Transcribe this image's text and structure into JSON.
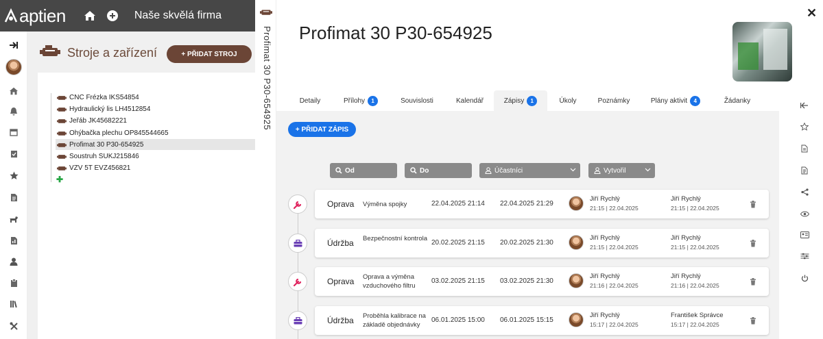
{
  "topbar": {
    "brand": "aptien",
    "company": "Naše skvělá firma"
  },
  "midpanel": {
    "title": "Stroje a zařízení",
    "add_button": "+ PŘIDAT STROJ",
    "tree": [
      {
        "label": "CNC Frézka IKS54854"
      },
      {
        "label": "Hydraulický lis LH4512854"
      },
      {
        "label": "Jeřáb JK45682221"
      },
      {
        "label": "Ohýbačka plechu OP845544665"
      },
      {
        "label": "Profimat 30 P30-654925",
        "selected": true
      },
      {
        "label": "Soustruh SUKJ215846"
      },
      {
        "label": "VZV 5T EVZ456821"
      }
    ]
  },
  "vertical_title": "Profimat 30 P30-654925",
  "detail": {
    "title": "Profimat 30 P30-654925",
    "tabs": [
      {
        "label": "Detaily",
        "badge": ""
      },
      {
        "label": "Přílohy",
        "badge": "1"
      },
      {
        "label": "Souvislosti",
        "badge": ""
      },
      {
        "label": "Kalendář",
        "badge": ""
      },
      {
        "label": "Zápisy",
        "badge": "1"
      },
      {
        "label": "Úkoly",
        "badge": ""
      },
      {
        "label": "Poznámky",
        "badge": ""
      },
      {
        "label": "Plány aktivit",
        "badge": "4"
      },
      {
        "label": "Žádanky",
        "badge": ""
      }
    ],
    "active_tab": "Zápisy",
    "add_button": "+ PŘIDAT ZÁPIS",
    "filters": {
      "od": "Od",
      "do": "Do",
      "ucastnici": "Účastníci",
      "vytvoril": "Vytvořil"
    },
    "records": [
      {
        "type": "Oprava",
        "icon": "wrench-icon",
        "desc": "Výměna spojky",
        "from": "22.04.2025 21:14",
        "to": "22.04.2025 21:29",
        "user1": "Jiří Rychlý",
        "user1_time": "21:15 | 22.04.2025",
        "user2": "Jiří Rychlý",
        "user2_time": "21:15 | 22.04.2025"
      },
      {
        "type": "Údržba",
        "icon": "toolbox-icon",
        "desc": "Bezpečnostní kontrola",
        "from": "20.02.2025 21:15",
        "to": "20.02.2025 21:30",
        "user1": "Jiří Rychlý",
        "user1_time": "21:15 | 22.04.2025",
        "user2": "Jiří Rychlý",
        "user2_time": "21:15 | 22.04.2025"
      },
      {
        "type": "Oprava",
        "icon": "wrench-icon",
        "desc": "Oprava a výměna vzduchového filtru",
        "from": "03.02.2025 21:15",
        "to": "03.02.2025 21:30",
        "user1": "Jiří Rychlý",
        "user1_time": "21:16 | 22.04.2025",
        "user2": "Jiří Rychlý",
        "user2_time": "21:16 | 22.04.2025"
      },
      {
        "type": "Údržba",
        "icon": "toolbox-icon",
        "desc": "Proběhla kalibrace na základě objednávky",
        "from": "06.01.2025 15:00",
        "to": "06.01.2025 15:15",
        "user1": "Jiří Rychlý",
        "user1_time": "15:17 | 22.04.2025",
        "user2": "František Správce",
        "user2_time": "15:17 | 22.04.2025"
      }
    ]
  },
  "colors": {
    "accent": "#1a73e8",
    "brand_brown": "#6b4536",
    "topbar": "#474747",
    "wrench": "#e0245e",
    "toolbox": "#6a3fb5"
  }
}
